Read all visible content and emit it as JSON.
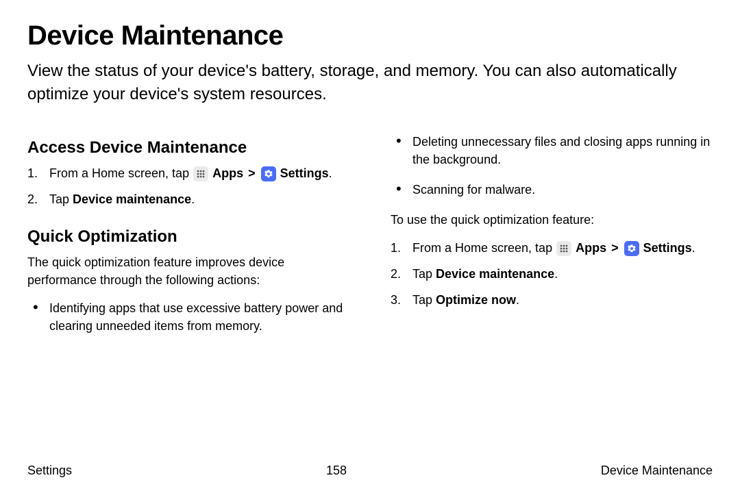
{
  "title": "Device Maintenance",
  "intro": "View the status of your device's battery, storage, and memory. You can also automatically optimize your device's system resources.",
  "section1": {
    "heading": "Access Device Maintenance",
    "step1_pre": "From a Home screen, tap ",
    "apps_label": "Apps",
    "chevron": ">",
    "settings_label": "Settings",
    "step1_post": ".",
    "step2_pre": "Tap ",
    "step2_bold": "Device maintenance",
    "step2_post": "."
  },
  "section2": {
    "heading": "Quick Optimization",
    "intro": "The quick optimization feature improves device performance through the following actions:",
    "bullet1": "Identifying apps that use excessive battery power and clearing unneeded items from memory."
  },
  "col2": {
    "bullet2": "Deleting unnecessary files and closing apps running in the background.",
    "bullet3": "Scanning for malware.",
    "lead": "To use the quick optimization feature:",
    "step1_pre": "From a Home screen, tap ",
    "apps_label": "Apps",
    "chevron": ">",
    "settings_label": "Settings",
    "step1_post": ".",
    "step2_pre": "Tap ",
    "step2_bold": "Device maintenance",
    "step2_post": ".",
    "step3_pre": "Tap ",
    "step3_bold": "Optimize now",
    "step3_post": "."
  },
  "footer": {
    "left": "Settings",
    "center": "158",
    "right": "Device Maintenance"
  }
}
